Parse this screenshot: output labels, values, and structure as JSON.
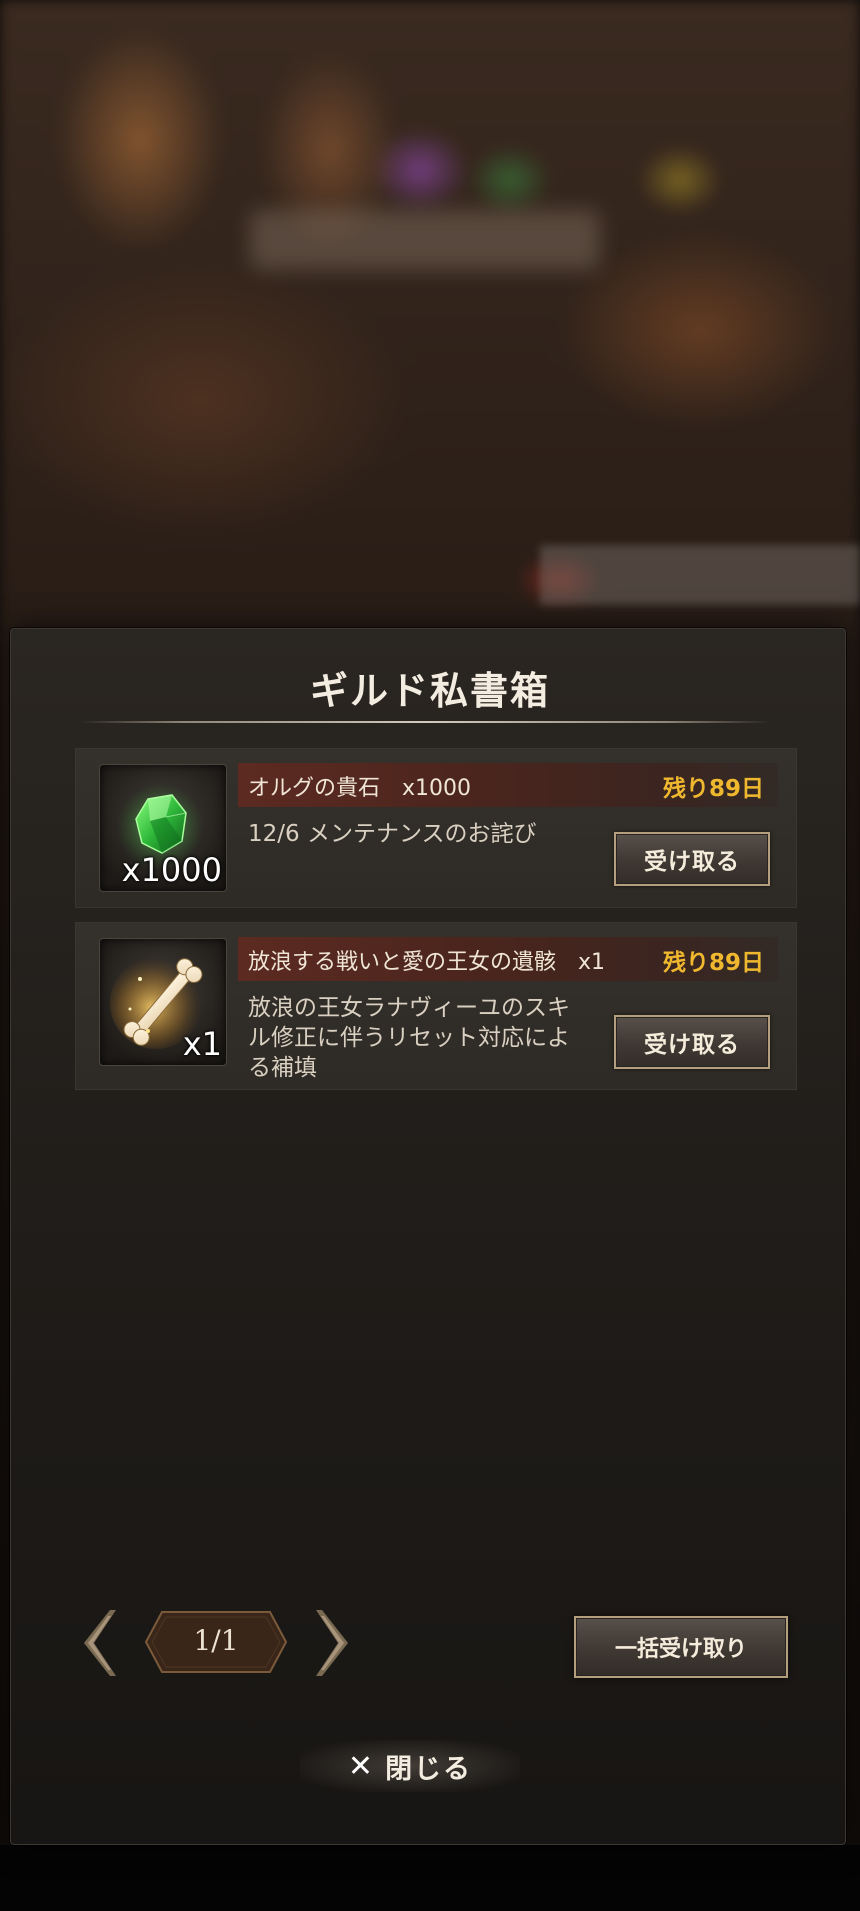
{
  "dialog": {
    "title": "ギルド私書箱"
  },
  "mails": [
    {
      "item_name": "オルグの貴石　x1000",
      "remaining": "残り89日",
      "description": "12/6 メンテナンスのお詫び",
      "quantity": "x1000",
      "icon": "green-gem-icon",
      "claim_label": "受け取る"
    },
    {
      "item_name": "放浪する戦いと愛の王女の遺骸　x1",
      "remaining": "残り89日",
      "description": "放浪の王女ラナヴィーユのスキル修正に伴うリセット対応による補填",
      "quantity": "x1",
      "icon": "golden-relic-bone-icon",
      "claim_label": "受け取る"
    }
  ],
  "pager": {
    "page_text": "1/1",
    "prev_icon": "chevron-left-icon",
    "next_icon": "chevron-right-icon"
  },
  "actions": {
    "claim_all_label": "一括受け取り",
    "close_label": "閉じる",
    "close_glyph": "✕"
  },
  "colors": {
    "remaining_text": "#f0b82e",
    "item_header": "#5c2a21",
    "button_border": "#b39e7e"
  }
}
